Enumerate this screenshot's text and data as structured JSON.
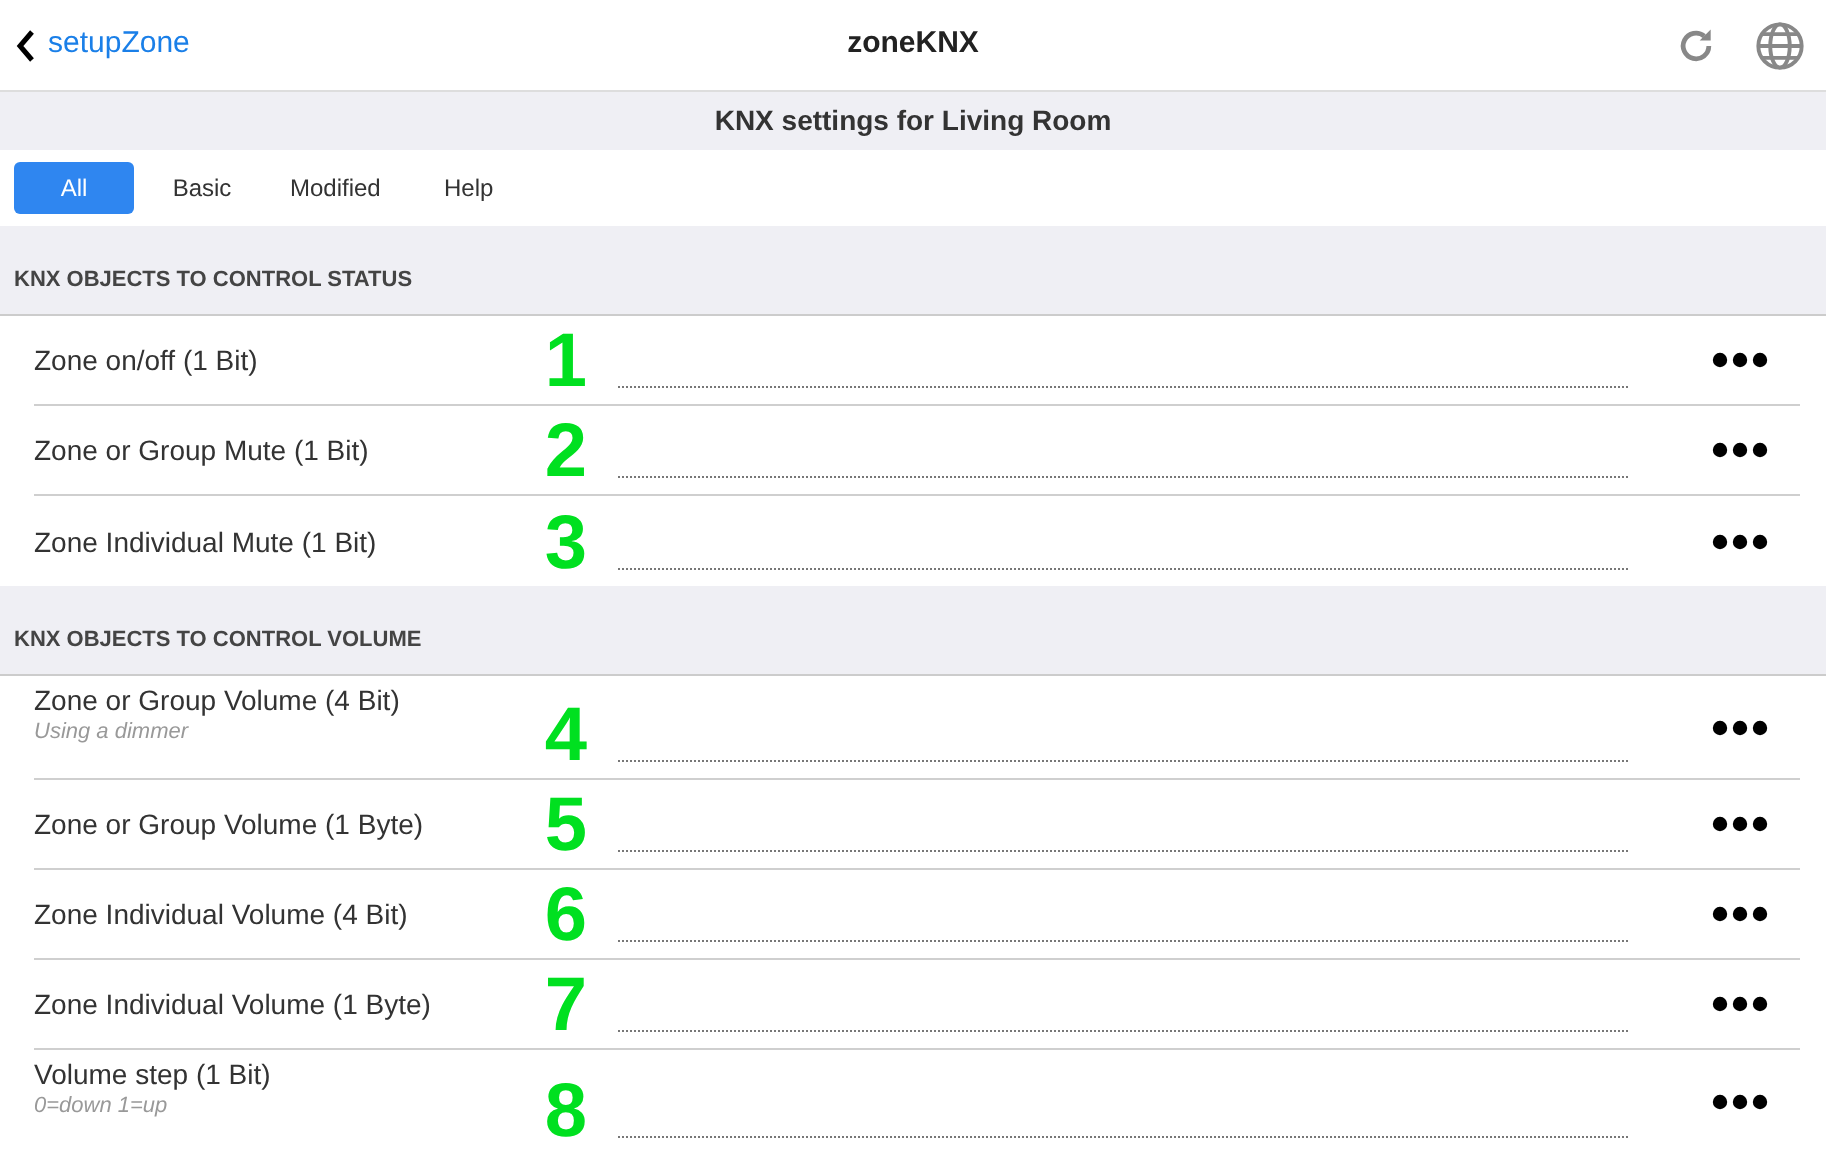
{
  "header": {
    "back_label": "setupZone",
    "title": "zoneKNX"
  },
  "subtitle": "KNX settings for Living Room",
  "tabs": [
    {
      "label": "All",
      "selected": true
    },
    {
      "label": "Basic",
      "selected": false
    },
    {
      "label": "Modified",
      "selected": false
    },
    {
      "label": "Help",
      "selected": false
    }
  ],
  "sections": [
    {
      "title": "KNX OBJECTS TO CONTROL STATUS",
      "rows": [
        {
          "label": "Zone on/off (1 Bit)",
          "marker": "1"
        },
        {
          "label": "Zone or Group Mute (1 Bit)",
          "marker": "2"
        },
        {
          "label": "Zone Individual Mute (1 Bit)",
          "marker": "3"
        }
      ]
    },
    {
      "title": "KNX OBJECTS TO CONTROL VOLUME",
      "rows": [
        {
          "label": "Zone or Group Volume (4 Bit)",
          "hint": "Using a dimmer",
          "marker": "4"
        },
        {
          "label": "Zone or Group Volume (1 Byte)",
          "marker": "5"
        },
        {
          "label": "Zone Individual Volume (4 Bit)",
          "marker": "6"
        },
        {
          "label": "Zone Individual Volume (1 Byte)",
          "marker": "7"
        },
        {
          "label": "Volume step (1 Bit)",
          "hint": "0=down 1=up",
          "marker": "8"
        }
      ]
    }
  ]
}
